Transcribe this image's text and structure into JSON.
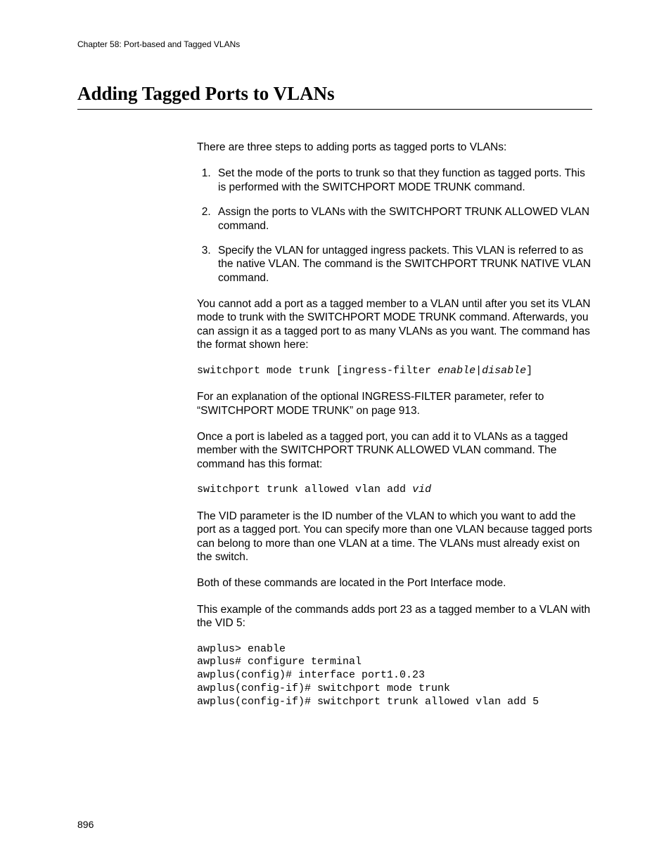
{
  "header": {
    "chapter": "Chapter 58: Port-based and Tagged VLANs"
  },
  "title": "Adding Tagged Ports to VLANs",
  "intro": "There are three steps to adding ports as tagged ports to VLANs:",
  "steps": {
    "s1": "Set the mode of the ports to trunk so that they function as tagged ports. This is performed with the SWITCHPORT MODE TRUNK command.",
    "s2": "Assign the ports to VLANs with the SWITCHPORT TRUNK ALLOWED VLAN command.",
    "s3": "Specify the VLAN for untagged ingress packets. This VLAN is referred to as the native VLAN. The command is the SWITCHPORT TRUNK NATIVE VLAN command."
  },
  "para1": "You cannot add a port as a tagged member to a VLAN until after you set its VLAN mode to trunk with the SWITCHPORT MODE TRUNK command. Afterwards, you can assign it as a tagged port to as many VLANs as you want. The command has the format shown here:",
  "code1_pre": "switchport mode trunk [ingress-filter ",
  "code1_ital": "enable|disable",
  "code1_post": "]",
  "para2": "For an explanation of the optional INGRESS-FILTER parameter, refer to “SWITCHPORT MODE TRUNK” on page 913.",
  "para3": "Once a port is labeled as a tagged port, you can add it to VLANs as a tagged member with the SWITCHPORT TRUNK ALLOWED VLAN command. The command has this format:",
  "code2_pre": "switchport trunk allowed vlan add ",
  "code2_ital": "vid",
  "para4": "The VID parameter is the ID number of the VLAN to which you want to add the port as a tagged port. You can specify more than one VLAN because tagged ports can belong to more than one VLAN at a time. The VLANs must already exist on the switch.",
  "para5": "Both of these commands are located in the Port Interface mode.",
  "para6": "This example of the commands adds port 23 as a tagged member to a VLAN with the VID 5:",
  "code3": "awplus> enable\nawplus# configure terminal\nawplus(config)# interface port1.0.23\nawplus(config-if)# switchport mode trunk\nawplus(config-if)# switchport trunk allowed vlan add 5",
  "page_number": "896"
}
